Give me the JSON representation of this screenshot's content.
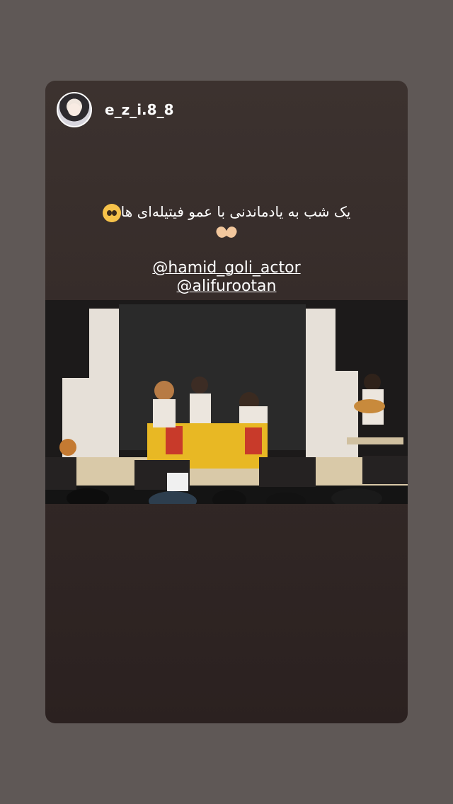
{
  "story": {
    "username": "e_z_i.8_8",
    "caption": {
      "line1": "یک شب به یادماندنی با عمو فیتیله‌ای ها",
      "emoji_1": "pleading-face-emoji",
      "emoji_2": "heart-hands-emoji"
    },
    "mentions": [
      "@hamid_goli_actor",
      "@alifurootan"
    ],
    "photo_icon": "stage-performance-photo"
  },
  "colors": {
    "page_background": "#5f5856",
    "card_background": "#3c322f",
    "text": "#ffffff"
  }
}
